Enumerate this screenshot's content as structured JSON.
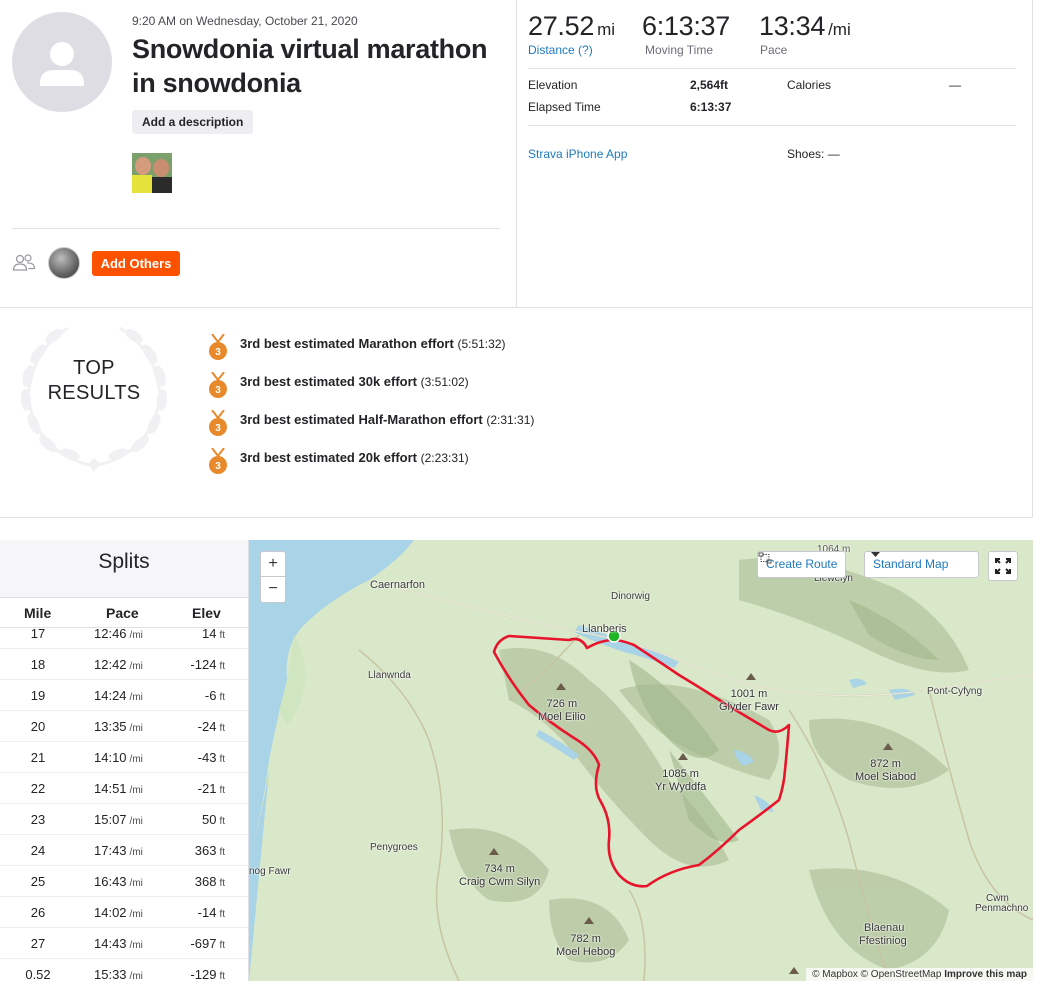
{
  "header": {
    "date_line": "9:20 AM on Wednesday, October 21, 2020",
    "title": "Snowdonia virtual marathon in snowdonia",
    "add_description": "Add a description",
    "add_others": "Add Others"
  },
  "stats": {
    "distance_value": "27.52",
    "distance_unit": "mi",
    "distance_label": "Distance (?)",
    "moving_time_value": "6:13:37",
    "moving_time_label": "Moving Time",
    "pace_value": "13:34",
    "pace_unit": "/mi",
    "pace_label": "Pace"
  },
  "details": {
    "elevation_label": "Elevation",
    "elevation_value": "2,564ft",
    "elapsed_label": "Elapsed Time",
    "elapsed_value": "6:13:37",
    "calories_label": "Calories",
    "calories_value": "—",
    "device": "Strava iPhone App",
    "shoes": "Shoes: —"
  },
  "top_results": {
    "title_line1": "TOP",
    "title_line2": "RESULTS",
    "items": [
      {
        "rank": "3",
        "text": "3rd best estimated Marathon effort",
        "time": "(5:51:32)"
      },
      {
        "rank": "3",
        "text": "3rd best estimated 30k effort",
        "time": "(3:51:02)"
      },
      {
        "rank": "3",
        "text": "3rd best estimated Half-Marathon effort",
        "time": "(2:31:31)"
      },
      {
        "rank": "3",
        "text": "3rd best estimated 20k effort",
        "time": "(2:23:31)"
      }
    ]
  },
  "splits": {
    "title": "Splits",
    "col_mile": "Mile",
    "col_pace": "Pace",
    "col_elev": "Elev",
    "pace_unit": "/mi",
    "elev_unit": "ft",
    "rows": [
      {
        "mile": "17",
        "pace": "12:46",
        "elev": "14"
      },
      {
        "mile": "18",
        "pace": "12:42",
        "elev": "-124"
      },
      {
        "mile": "19",
        "pace": "14:24",
        "elev": "-6"
      },
      {
        "mile": "20",
        "pace": "13:35",
        "elev": "-24"
      },
      {
        "mile": "21",
        "pace": "14:10",
        "elev": "-43"
      },
      {
        "mile": "22",
        "pace": "14:51",
        "elev": "-21"
      },
      {
        "mile": "23",
        "pace": "15:07",
        "elev": "50"
      },
      {
        "mile": "24",
        "pace": "17:43",
        "elev": "363"
      },
      {
        "mile": "25",
        "pace": "16:43",
        "elev": "368"
      },
      {
        "mile": "26",
        "pace": "14:02",
        "elev": "-14"
      },
      {
        "mile": "27",
        "pace": "14:43",
        "elev": "-697"
      },
      {
        "mile": "0.52",
        "pace": "15:33",
        "elev": "-129"
      }
    ]
  },
  "map": {
    "zoom_in": "+",
    "zoom_out": "−",
    "create_route": "Create Route",
    "map_style": "Standard Map",
    "route_color": "#e8142b",
    "start_color": "#1fb524",
    "places": {
      "caernarfon": "Caernarfon",
      "dinorwig": "Dinorwig",
      "llanberis": "Llanberis",
      "llanwnda": "Llanwnda",
      "penygroes": "Penygroes",
      "pont_cyfyng": "Pont-Cyfyng",
      "llewelyn": "Llewelyn",
      "nog_fawr": "nog Fawr",
      "blaenau": "Blaenau",
      "ffestiniog": "Ffestiniog",
      "cwm": "Cwm",
      "penmachno": "Penmachno",
      "top_cut": "1064 m"
    },
    "peaks": {
      "moel_eilio_h": "726 m",
      "moel_eilio": "Moel Eilio",
      "glyder_h": "1001 m",
      "glyder": "Glyder Fawr",
      "yr_wyddfa_h": "1085 m",
      "yr_wyddfa": "Yr Wyddfa",
      "siabod_h": "872 m",
      "siabod": "Moel Siabod",
      "silyn_h": "734 m",
      "silyn": "Craig Cwm Silyn",
      "hebog_h": "782 m",
      "hebog": "Moel Hebog"
    },
    "attribution_a": "© Mapbox © OpenStreetMap",
    "attribution_b": "Improve this map"
  }
}
